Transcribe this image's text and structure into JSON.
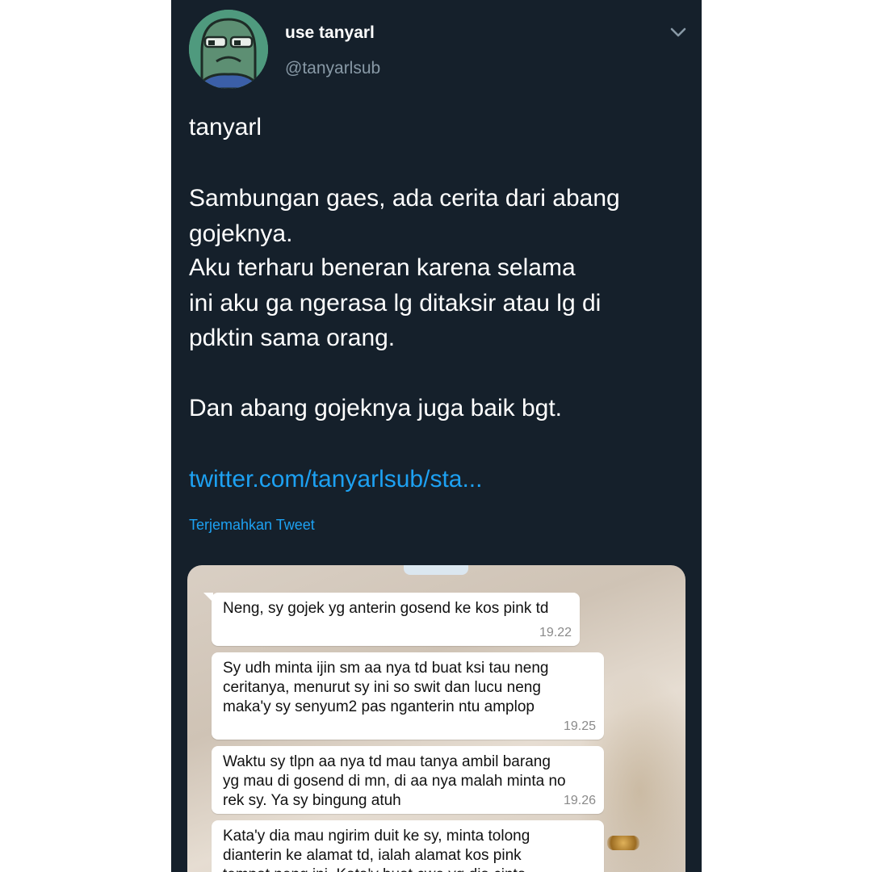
{
  "profile": {
    "display_name": "use tanyarl",
    "handle": "@tanyarlsub",
    "avatar_icon": "frog-avatar-icon"
  },
  "menu_icon": "chevron-down-icon",
  "tweet": {
    "lines": [
      "tanyarl",
      "Sambungan gaes, ada cerita dari abang",
      "gojeknya.",
      "Aku terharu beneran karena selama",
      "ini aku ga ngerasa lg ditaksir atau lg di",
      "pdktin sama orang.",
      "Dan abang gojeknya juga baik bgt."
    ],
    "link": "twitter.com/tanyarlsub/sta...",
    "translate_label": "Terjemahkan Tweet"
  },
  "chat": {
    "messages": [
      {
        "lines": [
          "Neng, sy gojek yg anterin gosend ke kos pink td"
        ],
        "time": "19.22"
      },
      {
        "lines": [
          "Sy udh minta ijin sm aa nya td buat ksi tau neng",
          "ceritanya, menurut sy ini so swit dan lucu neng",
          "maka'y sy senyum2 pas nganterin ntu amplop"
        ],
        "time": "19.25"
      },
      {
        "lines": [
          "Waktu sy tlpn aa nya td mau tanya ambil barang",
          "yg mau di gosend di mn, di aa nya malah minta no",
          "rek sy. Ya sy bingung atuh"
        ],
        "time": "19.26"
      },
      {
        "lines": [
          "Kata'y dia mau ngirim duit ke sy, minta tolong",
          "dianterin ke alamat td, ialah alamat kos pink",
          "tempat neng ini. Kata'y buat cwe yg dia cinta"
        ],
        "time": ""
      }
    ]
  },
  "colors": {
    "background": "#15202b",
    "text": "#ffffff",
    "secondary": "#8899a6",
    "accent": "#1da1f2"
  }
}
